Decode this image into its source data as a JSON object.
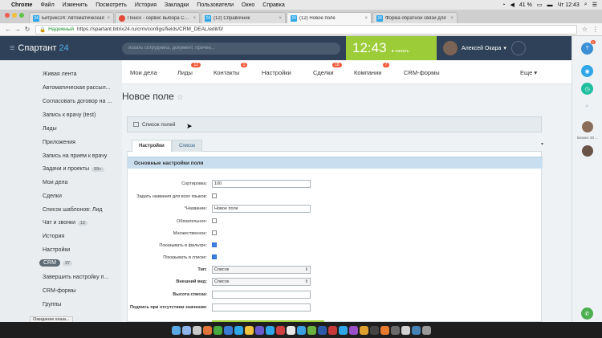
{
  "macbar": {
    "app": "Chrome",
    "menus": [
      "Файл",
      "Изменить",
      "Посмотреть",
      "История",
      "Закладки",
      "Пользователи",
      "Окно",
      "Справка"
    ],
    "battery": "41 %",
    "clock": "Чт 12:43"
  },
  "tabs": [
    {
      "title": "Битрикс24: Автоматическая",
      "fav_color": "#2fa6e8",
      "fav": "24"
    },
    {
      "title": "Пенсо - сервис выбора CRM",
      "fav_color": "#e24b3a",
      "fav": ""
    },
    {
      "title": "(12) Справочник",
      "fav_color": "#2fa6e8",
      "fav": "24"
    },
    {
      "title": "(12) Новое поле",
      "fav_color": "#2fa6e8",
      "fav": "24"
    },
    {
      "title": "Форма обратной связи для",
      "fav_color": "#2fa6e8",
      "fav": "24"
    }
  ],
  "address": {
    "secure_label": "Надежный",
    "url": "https://spartant.bitrix24.ru/crm/configs/fields/CRM_DEAL/edit/0/"
  },
  "header": {
    "logo_main": "Спартант",
    "logo_num": "24",
    "search_placeholder": "искать сотрудника, документ, прочее...",
    "time": "12:43",
    "time_status": "начать",
    "user_name": "Алексей Окара"
  },
  "rail": {
    "help_badge": "2",
    "avatar_caption": "Бизнес 30 ..."
  },
  "sidebar": {
    "items": [
      {
        "label": "Живая лента",
        "badge": ""
      },
      {
        "label": "Автоматическая рассыл...",
        "badge": ""
      },
      {
        "label": "Согласовать договор на ...",
        "badge": ""
      },
      {
        "label": "Запись к врачу (test)",
        "badge": ""
      },
      {
        "label": "Лиды",
        "badge": ""
      },
      {
        "label": "Приложения",
        "badge": ""
      },
      {
        "label": "Запись на прием к врачу",
        "badge": ""
      },
      {
        "label": "Задачи и проекты",
        "badge": "99+"
      },
      {
        "label": "Мои дела",
        "badge": ""
      },
      {
        "label": "Сделки",
        "badge": ""
      },
      {
        "label": "Список шаблонов: Лид",
        "badge": ""
      },
      {
        "label": "Чат и звонки",
        "badge": "12"
      },
      {
        "label": "История",
        "badge": ""
      },
      {
        "label": "Настройки",
        "badge": ""
      },
      {
        "label": "CRM",
        "badge": "37"
      },
      {
        "label": "Завершить настройку п...",
        "badge": ""
      },
      {
        "label": "CRM-формы",
        "badge": ""
      },
      {
        "label": "Группы",
        "badge": ""
      }
    ]
  },
  "topmenu": {
    "items": [
      {
        "label": "Мои дела",
        "count": ""
      },
      {
        "label": "Лиды",
        "count": "12"
      },
      {
        "label": "Контакты",
        "count": "1"
      },
      {
        "label": "Настройки",
        "count": ""
      },
      {
        "label": "Сделки",
        "count": "18"
      },
      {
        "label": "Компании",
        "count": "7"
      },
      {
        "label": "CRM-формы",
        "count": ""
      }
    ],
    "more": "Еще"
  },
  "page": {
    "title": "Новое поле",
    "list_link": "Список полей"
  },
  "form_tabs": [
    "Настройки",
    "Список"
  ],
  "form": {
    "section": "Основные настройки поля",
    "sort_label": "Сортировка:",
    "sort_value": "100",
    "all_lang_label": "Задать названия для всех языков:",
    "name_label": "*Название:",
    "name_value": "Новое поле",
    "required_label": "Обязательное:",
    "multiple_label": "Множественное:",
    "filter_label": "Показывать в фильтре:",
    "list_label": "Показывать в списке:",
    "type_label": "Тип:",
    "type_value": "Список",
    "view_label": "Внешний вид:",
    "view_value": "Список",
    "height_label": "Высота списка:",
    "empty_label": "Подпись при отсутствии значения:"
  },
  "status_text": "Ожидание кеша...",
  "dock_colors": [
    "#5aa9e6",
    "#8fb4e8",
    "#c9c9c9",
    "#e0743a",
    "#46a83e",
    "#3a7bd5",
    "#2fa6e8",
    "#f0c040",
    "#6a5acd",
    "#2fa6e8",
    "#d04040",
    "#e8e8e8",
    "#3aa0e0",
    "#6cb040",
    "#2d5aa8",
    "#c83a3a",
    "#2fa6e8",
    "#9c50c8",
    "#e0a030",
    "#444",
    "#e87a30",
    "#6a6a6a",
    "#d2d2d2",
    "#4682b4",
    "#999"
  ]
}
